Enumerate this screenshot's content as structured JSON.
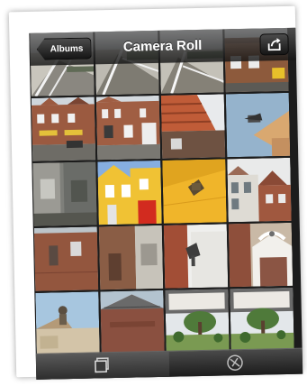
{
  "navbar": {
    "back_label": "Albums",
    "title": "Camera Roll",
    "share_icon": "share-icon"
  },
  "tabbar": {
    "tabs": [
      {
        "name": "photos",
        "icon": "photos-stack-icon",
        "selected": true
      },
      {
        "name": "places",
        "icon": "map-pin-icon",
        "selected": false
      }
    ]
  },
  "photos": [
    "bridge-railing-photo",
    "bridge-railing-photo",
    "bridge-railing-photo",
    "brick-house-photo",
    "dutch-houses-street-photo",
    "dutch-houses-street-photo",
    "rooftop-photo",
    "chimney-sky-photo",
    "stone-wall-photo",
    "yellow-house-photo",
    "yellow-wall-photo",
    "gabled-houses-photo",
    "brick-wall-photo",
    "building-corner-photo",
    "wall-lamp-photo",
    "gable-ornament-photo",
    "roof-statue-photo",
    "tiled-roof-photo",
    "garden-photo",
    "garden-photo"
  ],
  "colors": {
    "navbar": "#2a2a2a",
    "frame": "#ffffff",
    "screen_bg": "#1c1c1c"
  }
}
